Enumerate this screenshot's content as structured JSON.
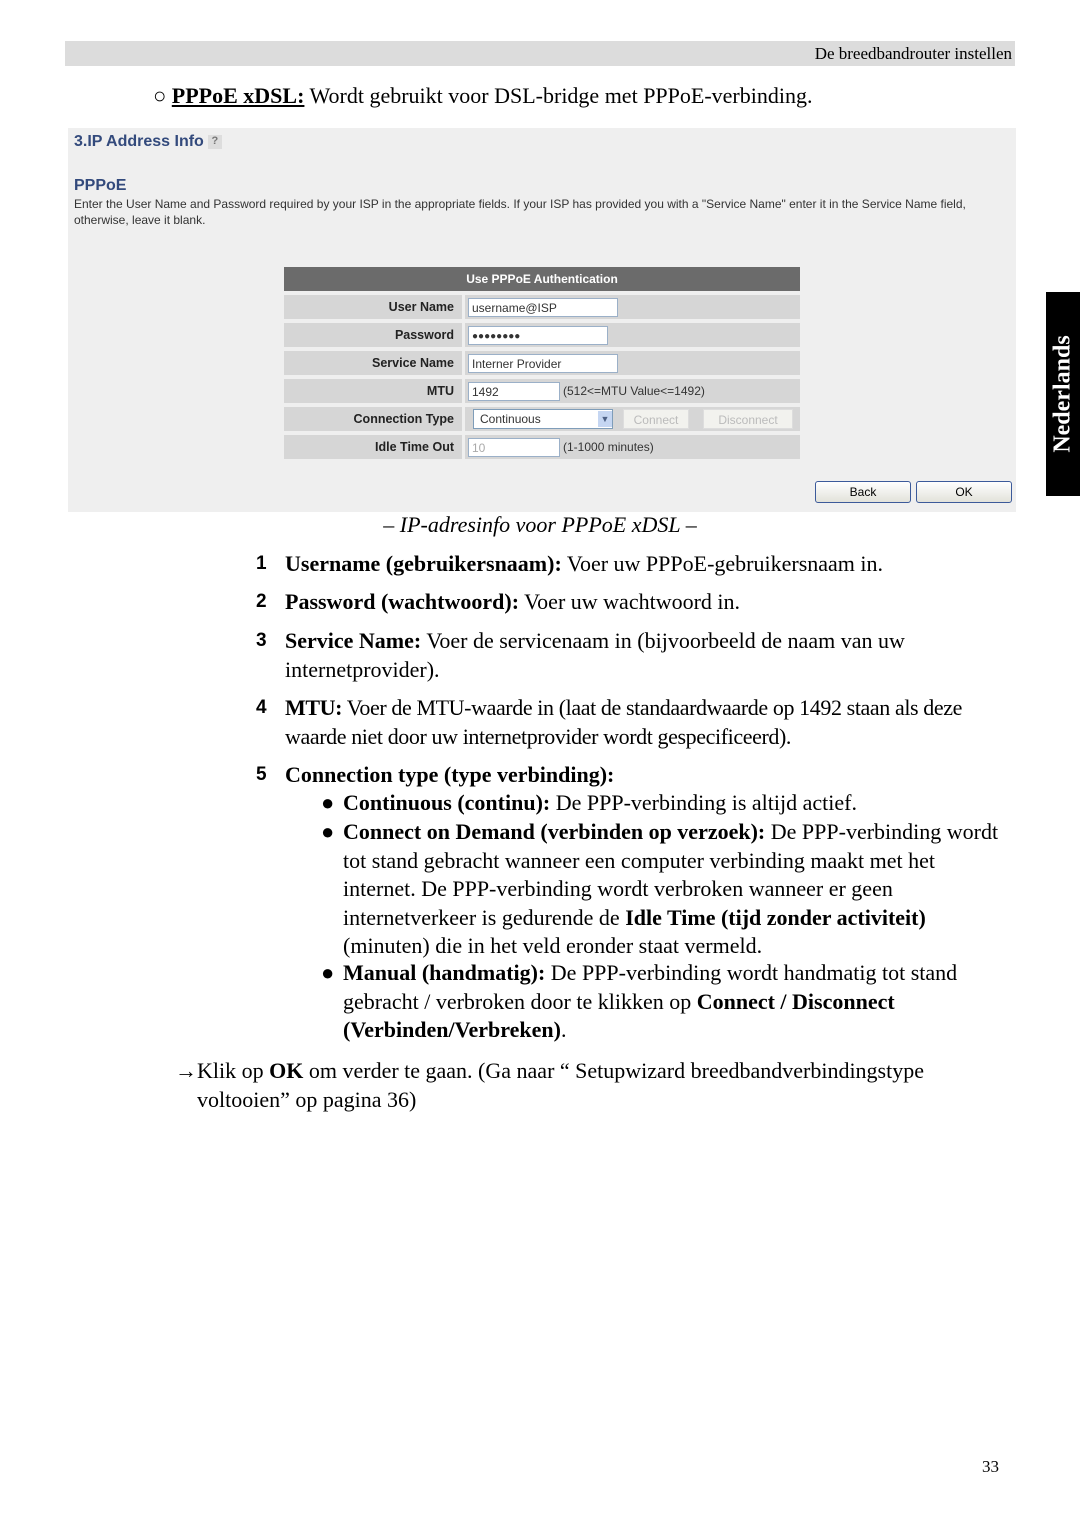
{
  "header": {
    "running_title": "De breedbandrouter instellen"
  },
  "intro": {
    "bullet": "○",
    "term": "PPPoE xDSL:",
    "text": " Wordt gebruikt voor DSL-bridge met PPPoE-verbinding."
  },
  "screenshot": {
    "section_title": "3.IP Address Info",
    "help_icon": "?",
    "subtitle": "PPPoE",
    "description": "Enter the User Name and Password required by your ISP in the appropriate fields. If your ISP has provided you with a \"Service Name\" enter it in the Service Name field, otherwise, leave it blank.",
    "table_header": "Use PPPoE Authentication",
    "user_name_label": "User Name",
    "user_name": "username@ISP",
    "password_label": "Password",
    "password": "●●●●●●●●",
    "service_name_label": "Service Name",
    "service_name": "Interner Provider",
    "mtu_label": "MTU",
    "mtu": "1492",
    "mtu_hint": "(512<=MTU Value<=1492)",
    "connection_type_label": "Connection Type",
    "connection_type": "Continuous",
    "connect": "Connect",
    "disconnect": "Disconnect",
    "idle_label": "Idle Time Out",
    "idle": "10",
    "idle_hint": "(1-1000 minutes)",
    "back": "Back",
    "ok": "OK"
  },
  "caption": "– IP-adresinfo voor PPPoE xDSL –",
  "items": [
    {
      "n": "1",
      "b": "Username (gebruikersnaam):",
      "t": " Voer uw PPPoE-gebruikersnaam in."
    },
    {
      "n": "2",
      "b": "Password (wachtwoord):",
      "t": " Voer uw wachtwoord in."
    },
    {
      "n": "3",
      "b": "Service Name:",
      "t": " Voer de servicenaam in (bijvoorbeeld de naam van uw internetprovider)."
    },
    {
      "n": "4",
      "b": "MTU:",
      "t": " Voer de MTU-waarde in (laat de standaardwaarde op 1492 staan als deze waarde niet door uw internetprovider wordt gespecificeerd)."
    },
    {
      "n": "5",
      "b": "Connection type (type verbinding):",
      "t": ""
    }
  ],
  "subitems": [
    {
      "b": "Continuous (continu):",
      "t": " De PPP-verbinding is altijd actief."
    },
    {
      "b": "Connect on Demand (verbinden op verzoek):",
      "t1": " De PPP-verbinding wordt tot stand gebracht wanneer een computer verbinding maakt met het internet. De PPP-verbinding wordt verbroken wanneer er geen internetverkeer is gedurende de ",
      "b2": "Idle Time (tijd zonder activiteit)",
      "t2": " (minuten) die in het veld eronder staat vermeld."
    },
    {
      "b": "Manual (handmatig):",
      "t1": " De PPP-verbinding wordt handmatig tot stand gebracht / verbroken door te klikken op ",
      "b2": "Connect / Disconnect (Verbinden/Verbreken)",
      "t2": "."
    }
  ],
  "bullet": "●",
  "footer_note": {
    "arrow": "→",
    "t1": "Klik op ",
    "b": "OK",
    "t2": " om verder te gaan. (Ga naar “ Setupwizard breedbandverbindingstype voltooien” op pagina 36)"
  },
  "side_tab": "Nederlands",
  "page_number": "33"
}
